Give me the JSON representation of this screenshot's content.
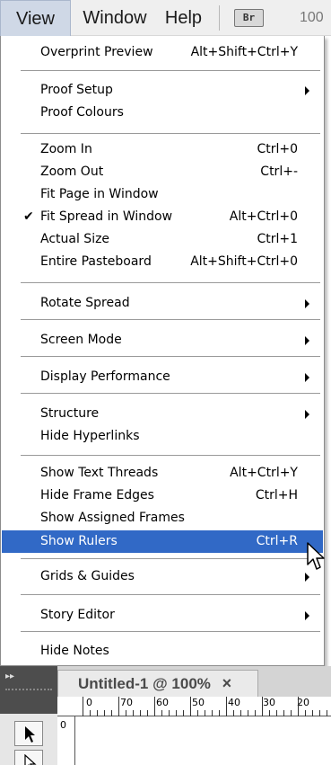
{
  "menubar": {
    "items": [
      "View",
      "Window",
      "Help"
    ],
    "bridge_label": "Br",
    "zoom_value": "100"
  },
  "view_menu": {
    "items": [
      {
        "label": "Overprint Preview",
        "shortcut": "Alt+Shift+Ctrl+Y"
      },
      {
        "label": "Proof Setup",
        "submenu": true
      },
      {
        "label": "Proof Colours"
      },
      {
        "label": "Zoom In",
        "shortcut": "Ctrl+0"
      },
      {
        "label": "Zoom Out",
        "shortcut": "Ctrl+-"
      },
      {
        "label": "Fit Page in Window"
      },
      {
        "label": "Fit Spread in Window",
        "shortcut": "Alt+Ctrl+0",
        "checked": true
      },
      {
        "label": "Actual Size",
        "shortcut": "Ctrl+1"
      },
      {
        "label": "Entire Pasteboard",
        "shortcut": "Alt+Shift+Ctrl+0"
      },
      {
        "label": "Rotate Spread",
        "submenu": true
      },
      {
        "label": "Screen Mode",
        "submenu": true
      },
      {
        "label": "Display Performance",
        "submenu": true
      },
      {
        "label": "Structure",
        "submenu": true
      },
      {
        "label": "Hide Hyperlinks"
      },
      {
        "label": "Show Text Threads",
        "shortcut": "Alt+Ctrl+Y"
      },
      {
        "label": "Hide Frame Edges",
        "shortcut": "Ctrl+H"
      },
      {
        "label": "Show Assigned Frames"
      },
      {
        "label": "Show Rulers",
        "shortcut": "Ctrl+R",
        "highlighted": true
      },
      {
        "label": "Grids & Guides",
        "submenu": true
      },
      {
        "label": "Story Editor",
        "submenu": true
      },
      {
        "label": "Hide Notes"
      }
    ],
    "check_mark": "✔"
  },
  "document": {
    "tab_title": "Untitled-1 @ 100%",
    "tab_close": "×",
    "ruler_h_labels": [
      "0",
      "70",
      "60",
      "50",
      "40",
      "30",
      "20"
    ],
    "ruler_v_label": "0"
  },
  "colors": {
    "highlight": "#3169c6",
    "menubar_bg": "#efefef",
    "tool_panel": "#4d4d4d"
  }
}
